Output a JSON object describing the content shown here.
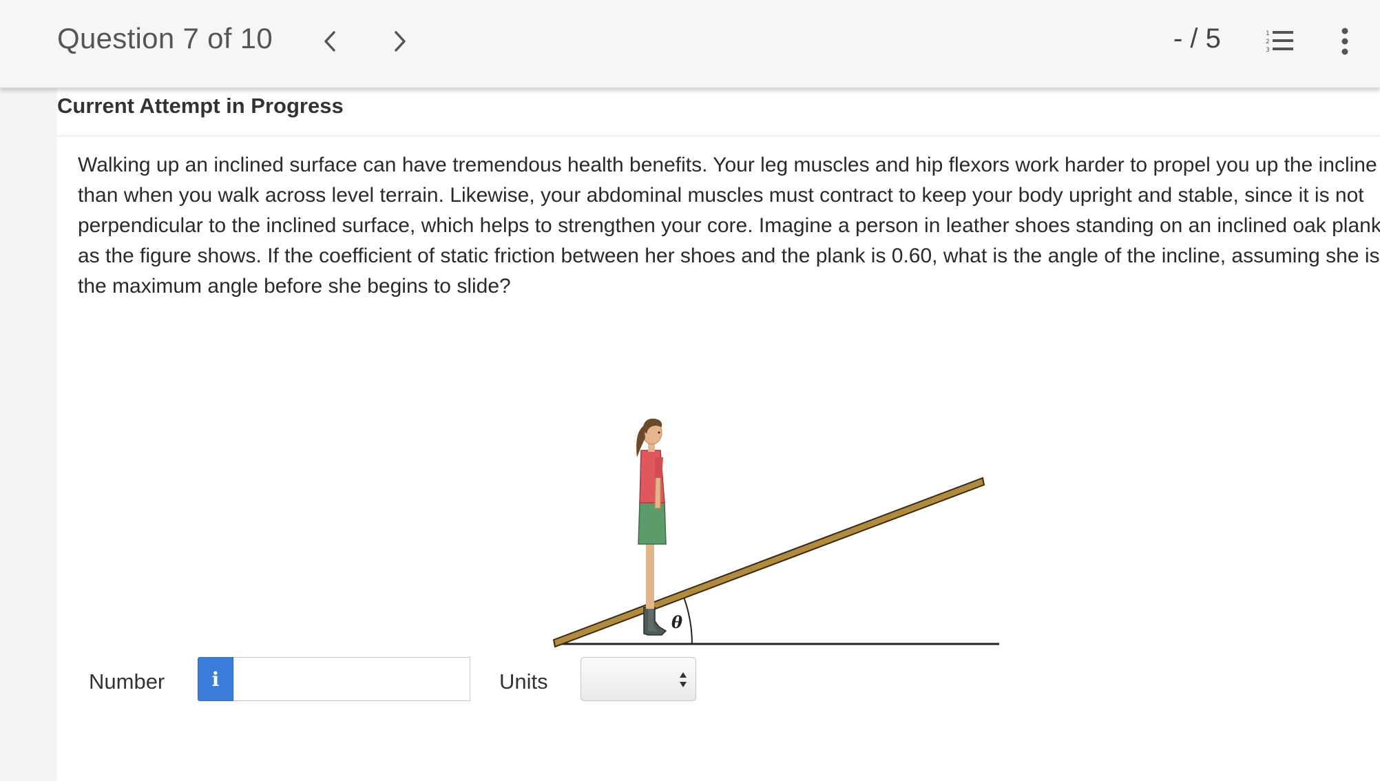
{
  "header": {
    "question_label": "Question 7 of 10",
    "prev_icon": "chevron-left-icon",
    "next_icon": "chevron-right-icon",
    "score": "- / 5",
    "list_icon": "numbered-list-icon",
    "more_icon": "more-vertical-icon"
  },
  "attempt": {
    "title": "Current Attempt in Progress"
  },
  "question": {
    "text": "Walking up an inclined surface can have tremendous health benefits. Your leg muscles and hip flexors work harder to propel you up the incline than when you walk across level terrain. Likewise, your abdominal muscles must contract to keep your body upright and stable, since it is not perpendicular to the inclined surface, which helps to strengthen your core. Imagine a person in leather shoes standing on an inclined oak plank, as the figure shows. If the coefficient of static friction between her shoes and the plank is 0.60, what is the angle of the incline, assuming she is at the maximum angle before she begins to slide?"
  },
  "figure": {
    "angle_label": "θ"
  },
  "answer": {
    "number_label": "Number",
    "info_icon_text": "i",
    "number_value": "",
    "units_label": "Units",
    "units_selected": ""
  },
  "colors": {
    "accent": "#3b7dd8",
    "plank": "#b08a3e",
    "shirt": "#e0575c",
    "skirt": "#5d9b6a"
  }
}
